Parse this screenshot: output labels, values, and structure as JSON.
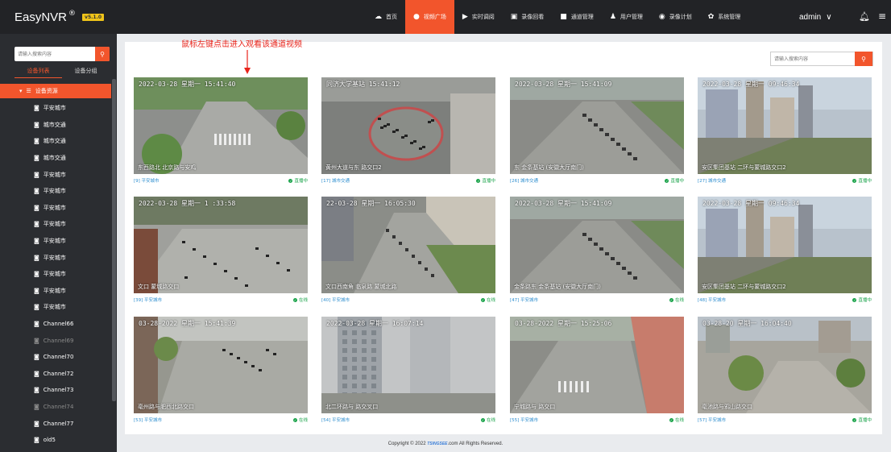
{
  "app": {
    "name": "EasyNVR",
    "reg": "®",
    "version": "v5.1.0"
  },
  "nav": [
    {
      "label": "首页",
      "icon": "home-icon",
      "glyph": "☁"
    },
    {
      "label": "视频广场",
      "icon": "video-square-icon",
      "glyph": "●",
      "active": true
    },
    {
      "label": "实时调阅",
      "icon": "play-icon",
      "glyph": "▶"
    },
    {
      "label": "录像回看",
      "icon": "recording-icon",
      "glyph": "▣"
    },
    {
      "label": "通道管理",
      "icon": "channel-icon",
      "glyph": "■"
    },
    {
      "label": "用户管理",
      "icon": "user-icon",
      "glyph": "♟"
    },
    {
      "label": "录像计划",
      "icon": "schedule-icon",
      "glyph": "◉"
    },
    {
      "label": "系统管理",
      "icon": "gear-icon",
      "glyph": "✿"
    }
  ],
  "user": {
    "name": "admin",
    "caret": "∨"
  },
  "sidebar": {
    "search_placeholder": "请输入搜索内容",
    "tabs": [
      "设备列表",
      "设备分组"
    ],
    "root": "设备资源",
    "items": [
      {
        "label": "平安城市",
        "dim": false
      },
      {
        "label": "城市交通",
        "dim": false
      },
      {
        "label": "城市交通",
        "dim": false
      },
      {
        "label": "城市交通",
        "dim": false
      },
      {
        "label": "平安城市",
        "dim": false
      },
      {
        "label": "平安城市",
        "dim": false
      },
      {
        "label": "平安城市",
        "dim": false
      },
      {
        "label": "平安城市",
        "dim": false
      },
      {
        "label": "平安城市",
        "dim": false
      },
      {
        "label": "平安城市",
        "dim": false
      },
      {
        "label": "平安城市",
        "dim": false
      },
      {
        "label": "平安城市",
        "dim": false
      },
      {
        "label": "平安城市",
        "dim": false
      },
      {
        "label": "Channel66",
        "dim": false
      },
      {
        "label": "Channel69",
        "dim": true
      },
      {
        "label": "Channel70",
        "dim": false
      },
      {
        "label": "Channel72",
        "dim": false
      },
      {
        "label": "Channel73",
        "dim": false
      },
      {
        "label": "Channel74",
        "dim": true
      },
      {
        "label": "Channel77",
        "dim": false
      },
      {
        "label": "old5",
        "dim": false
      }
    ]
  },
  "main": {
    "hint": "鼠标左键点击进入观看该通道视频",
    "search_placeholder": "请输入搜索内容",
    "cards": [
      {
        "channel": "[9] 平安城市",
        "status": "直播中",
        "osd": "2022-03-28 星期一 15:41:40",
        "label": "东西路北    北京路与安鸡",
        "scene": "cross"
      },
      {
        "channel": "[17] 城市交通",
        "status": "直播中",
        "osd": "同济大学基站    15:41:12",
        "label": "黄州大道与东    路交口2",
        "scene": "circle"
      },
      {
        "channel": "[26] 城市交通",
        "status": "直播中",
        "osd": "2022-03-28 星期一 15:41:09",
        "label": "东    金条基站 (安徽大厅南门)",
        "scene": "road"
      },
      {
        "channel": "[27] 城市交通",
        "status": "直播中",
        "osd": "2022-03-28 星期一 09:46:34",
        "label": "安区集团基站    二环与蒙城路交口2",
        "scene": "city"
      },
      {
        "channel": "[39] 平安城市",
        "status": "在线",
        "osd": "2022-03-28 星期一 1 :33:58",
        "label": "文口    蒙城路交口",
        "scene": "square"
      },
      {
        "channel": "[40] 平安城市",
        "status": "在线",
        "osd": "22-03-28 星期一 16:05:30",
        "label": "文口西南角    临泉路 蒙城北路",
        "scene": "street"
      },
      {
        "channel": "[47] 平安城市",
        "status": "在线",
        "osd": "2022-03-28 星期一 15:41:09",
        "label": "金条路东    金条基站 (安徽大厅南门)",
        "scene": "road"
      },
      {
        "channel": "[48] 平安城市",
        "status": "直播中",
        "osd": "2022-03-28 星期一 09:46:34",
        "label": "安区集团基站    二环与蒙城路交口2",
        "scene": "city"
      },
      {
        "channel": "[53] 平安城市",
        "status": "在线",
        "osd": "03-28-2022 星期一 15:41:39",
        "label": "亳州路与肥西北路交口",
        "scene": "junction"
      },
      {
        "channel": "[54] 平安城市",
        "status": "在线",
        "osd": "2022-03-28 星期一 16:07:14",
        "label": "北二环路与    路交叉口",
        "scene": "building"
      },
      {
        "channel": "[55] 平安城市",
        "status": "在线",
        "osd": "03-28-2022 星期一 15:25:06",
        "label": "宁城路与    路交口",
        "scene": "corner"
      },
      {
        "channel": "[57] 平安城市",
        "status": "直播中",
        "osd": "03-28-20 星期一 16:04:40",
        "label": "亳池路与鸦山路交口",
        "scene": "plaza"
      }
    ]
  },
  "footer": {
    "pre": "Copyright © 2022 ",
    "logo": "TSINGSEE",
    "post": ".com All Rights Reserved."
  }
}
